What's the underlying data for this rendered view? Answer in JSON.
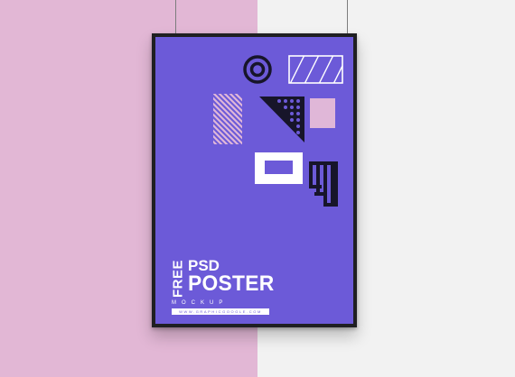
{
  "poster": {
    "free": "FREE",
    "psd": "PSD",
    "title": "POSTER",
    "subtitle": "MOCKUP",
    "url": "WWW.GRAPHICGOOGLE.COM"
  },
  "colors": {
    "wall_left": "#e2b7d5",
    "wall_right": "#f2f2f2",
    "frame": "#1f1f22",
    "poster_bg": "#6c5ad8",
    "shape_dark": "#17152a",
    "shape_light": "#e0b7d8",
    "white": "#ffffff"
  },
  "icons": [
    "concentric-circle-icon",
    "striped-rectangle-icon",
    "striped-tile-icon",
    "dotted-triangle-icon",
    "pink-square-icon",
    "hollow-rectangle-icon",
    "striped-bracket-icon"
  ]
}
